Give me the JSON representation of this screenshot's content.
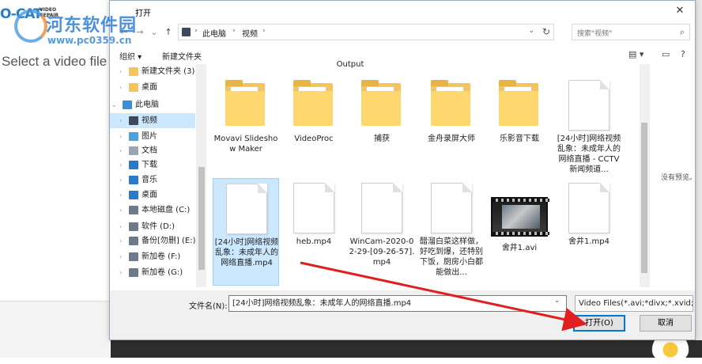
{
  "app": {
    "logo": "O-CAT",
    "logo_sub_1": "VIDEO",
    "logo_sub_2": "REPAIR",
    "hint": "Select a video file t"
  },
  "watermark": {
    "title": "河东软件园",
    "url": "www.pc0359.cn"
  },
  "dialog": {
    "title": "打开",
    "close": "✕",
    "address": {
      "crumbs": [
        "此电脑",
        "视频"
      ]
    },
    "search_placeholder": "搜索\"视频\"",
    "toolbar": {
      "organize": "组织 ▾",
      "new_folder": "新建文件夹"
    },
    "nav": {
      "items": [
        {
          "label": "新建文件夹 (3)",
          "icon": "folder-icon",
          "color": "#f3c55c",
          "indent": 1
        },
        {
          "label": "桌面",
          "icon": "folder-icon",
          "color": "#f3c55c",
          "indent": 1
        },
        {
          "label": "此电脑",
          "icon": "computer-icon",
          "color": "#3b8fd6",
          "indent": 0
        },
        {
          "label": "视频",
          "icon": "video-folder-icon",
          "color": "#3c4a5c",
          "indent": 1,
          "selected": true
        },
        {
          "label": "图片",
          "icon": "pictures-icon",
          "color": "#4aa3df",
          "indent": 1
        },
        {
          "label": "文档",
          "icon": "documents-icon",
          "color": "#9aa6b2",
          "indent": 1
        },
        {
          "label": "下载",
          "icon": "download-icon",
          "color": "#2b79c9",
          "indent": 1
        },
        {
          "label": "音乐",
          "icon": "music-icon",
          "color": "#2b79c9",
          "indent": 1
        },
        {
          "label": "桌面",
          "icon": "desktop-icon",
          "color": "#2b79c9",
          "indent": 1
        },
        {
          "label": "本地磁盘 (C:)",
          "icon": "drive-icon",
          "color": "#6c7a89",
          "indent": 1
        },
        {
          "label": "软件 (D:)",
          "icon": "drive-icon",
          "color": "#6c7a89",
          "indent": 1
        },
        {
          "label": "备份[勿删] (E:)",
          "icon": "drive-icon",
          "color": "#6c7a89",
          "indent": 1
        },
        {
          "label": "新加卷 (F:)",
          "icon": "drive-icon",
          "color": "#6c7a89",
          "indent": 1
        },
        {
          "label": "新加卷 (G:)",
          "icon": "drive-icon",
          "color": "#6c7a89",
          "indent": 1
        }
      ]
    },
    "files": {
      "top_cut_label": "Output",
      "items": [
        {
          "name": "Movavi Slideshow Maker",
          "type": "folder"
        },
        {
          "name": "VideoProc",
          "type": "folder"
        },
        {
          "name": "捕获",
          "type": "folder"
        },
        {
          "name": "金舟录屏大师",
          "type": "folder"
        },
        {
          "name": "乐影音下载",
          "type": "folder"
        },
        {
          "name": "[24小时]网络视频乱象：未成年人的网络直播 - CCTV 新闻频道...",
          "type": "doc"
        },
        {
          "name": "[24小时]网络视频乱象：未成年人的网络直播.mp4",
          "type": "doc",
          "selected": true
        },
        {
          "name": "heb.mp4",
          "type": "doc"
        },
        {
          "name": "WinCam-2020-02-29-[09-26-57].mp4",
          "type": "doc"
        },
        {
          "name": "醋溜白菜这样做，好吃到爆，还特别下饭，厨房小白都能做出...",
          "type": "doc"
        },
        {
          "name": "舍井1.avi",
          "type": "video"
        },
        {
          "name": "舍井1.mp4",
          "type": "doc"
        }
      ]
    },
    "preview_text": "没有预览。",
    "footer": {
      "filename_label": "文件名(N):",
      "filename_value": "[24小时]网络视频乱象：未成年人的网络直播.mp4",
      "filetype": "Video Files(*.avi;*divx;*.xvid;*",
      "open_button": "打开(O)",
      "cancel_button": "取消"
    }
  },
  "colors": {
    "accent": "#0078d7",
    "selection": "#cce8ff",
    "arrow": "#e02020"
  }
}
